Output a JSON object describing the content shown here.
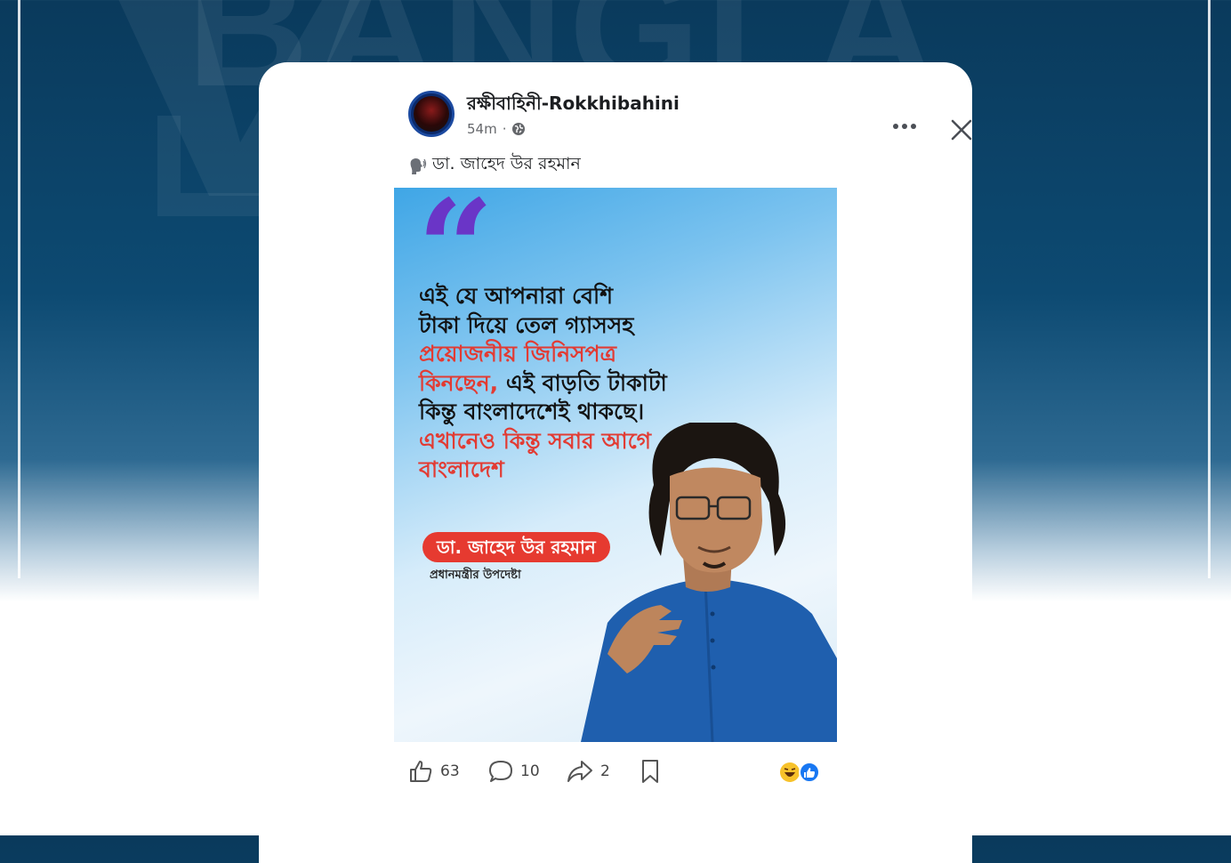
{
  "background": {
    "wordmark": "BANGLA",
    "accent": "#0d4a72"
  },
  "post": {
    "page_name": "রক্ষীবাহিনী-Rokkhibahini",
    "time": "54m",
    "privacy_icon": "globe-icon",
    "caption_icon": "speaking-head-icon",
    "caption": "ডা. জাহেদ উর রহমান"
  },
  "image": {
    "quote_lines": [
      {
        "text": "এই যে আপনারা বেশি"
      },
      {
        "text": "টাকা দিয়ে তেল গ্যাসসহ"
      },
      {
        "text": "প্রয়োজনীয় জিনিসপত্র"
      },
      {
        "red": "কিনছেন,",
        "text": " এই বাড়তি টাকাটা"
      },
      {
        "text": "কিন্তু বাংলাদেশেই থাকছে।"
      },
      {
        "text": "এখানেও কিন্তু সবার আগে"
      },
      {
        "text": "বাংলাদেশ"
      }
    ],
    "name": "ডা. জাহেদ উর রহমান",
    "designation": "প্রধানমন্ত্রীর উপদেষ্টা",
    "colors": {
      "accent_red": "#e23b33",
      "quote_purple": "#6a35c7"
    }
  },
  "actions": {
    "likes": "63",
    "comments": "10",
    "shares": "2",
    "reaction_icons": [
      "haha-icon",
      "like-icon"
    ]
  }
}
